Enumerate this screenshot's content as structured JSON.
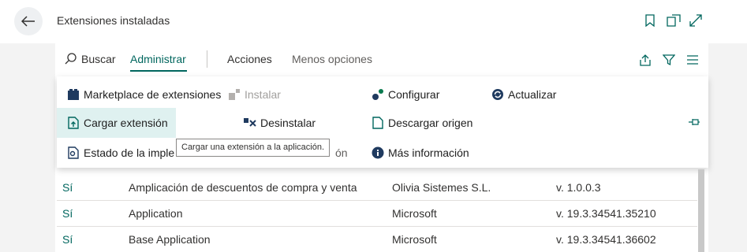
{
  "header": {
    "title": "Extensiones instaladas",
    "icons": [
      "back-arrow-icon",
      "bookmark-icon",
      "open-new-window-icon",
      "expand-icon"
    ]
  },
  "tabs": {
    "search": "Buscar",
    "administrar": "Administrar",
    "acciones": "Acciones",
    "menos": "Menos opciones"
  },
  "menu": {
    "marketplace": "Marketplace de extensiones",
    "instalar": "Instalar",
    "configurar": "Configurar",
    "actualizar": "Actualizar",
    "cargar": "Cargar extensión",
    "desinstalar": "Desinstalar",
    "descargar": "Descargar origen",
    "estado_prefix": "Estado de la imple",
    "hidden_suffix": "ón",
    "mas_info": "Más información"
  },
  "tooltip": "Cargar una extensión a la aplicación.",
  "rows": [
    {
      "installed": "Sí",
      "name": "Amplicación de descuentos de compra y venta",
      "publisher": "Olivia Sistemes S.L.",
      "version": "v. 1.0.0.3"
    },
    {
      "installed": "Sí",
      "name": "Application",
      "publisher": "Microsoft",
      "version": "v. 19.3.34541.35210"
    },
    {
      "installed": "Sí",
      "name": "Base Application",
      "publisher": "Microsoft",
      "version": "v. 19.3.34541.36602"
    }
  ],
  "colors": {
    "accent": "#00665e",
    "hover": "#dff1f0",
    "panel_bg": "#f3f3f3"
  }
}
